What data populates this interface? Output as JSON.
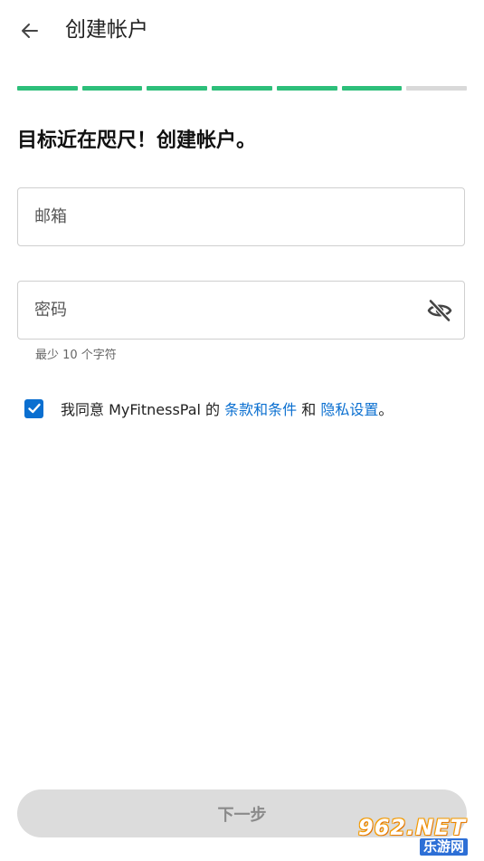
{
  "header": {
    "title": "创建帐户",
    "back_icon": "arrow-left-icon"
  },
  "progress": {
    "completed_steps": 6,
    "total_steps": 7,
    "active_color": "#2dbf7a",
    "inactive_color": "#d9d9d9"
  },
  "main": {
    "headline": "目标近在咫尺！创建帐户。",
    "email": {
      "placeholder": "邮箱",
      "value": ""
    },
    "password": {
      "placeholder": "密码",
      "value": "",
      "toggle_icon": "eye-off-icon",
      "hint": "最少 10 个字符"
    },
    "agreement": {
      "checked": true,
      "prefix": "我同意 MyFitnessPal 的 ",
      "terms_link": "条款和条件",
      "middle": " 和 ",
      "privacy_link": "隐私设置",
      "suffix": "。"
    },
    "next_button": "下一步"
  },
  "watermark": {
    "main": "962.NET",
    "sub": "乐游网"
  },
  "colors": {
    "accent_blue": "#0a6fd0",
    "checkbox_blue": "#0a6fd0",
    "button_disabled": "#dcdcdc"
  }
}
